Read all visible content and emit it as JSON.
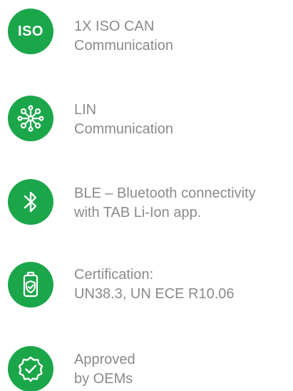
{
  "colors": {
    "accent": "#1ba64a",
    "text": "#8a8a8a",
    "icon_foreground": "#ffffff"
  },
  "features": [
    {
      "icon": "iso-badge-icon",
      "icon_text": "ISO",
      "line1": "1X ISO CAN",
      "line2": "Communication"
    },
    {
      "icon": "network-nodes-icon",
      "line1": "LIN",
      "line2": "Communication"
    },
    {
      "icon": "bluetooth-icon",
      "line1": "BLE – Bluetooth connectivity",
      "line2": "with TAB Li-Ion app."
    },
    {
      "icon": "battery-shield-icon",
      "line1": "Certification:",
      "line2": "UN38.3, UN ECE R10.06"
    },
    {
      "icon": "approved-badge-icon",
      "line1": "Approved",
      "line2": "by OEMs"
    }
  ]
}
